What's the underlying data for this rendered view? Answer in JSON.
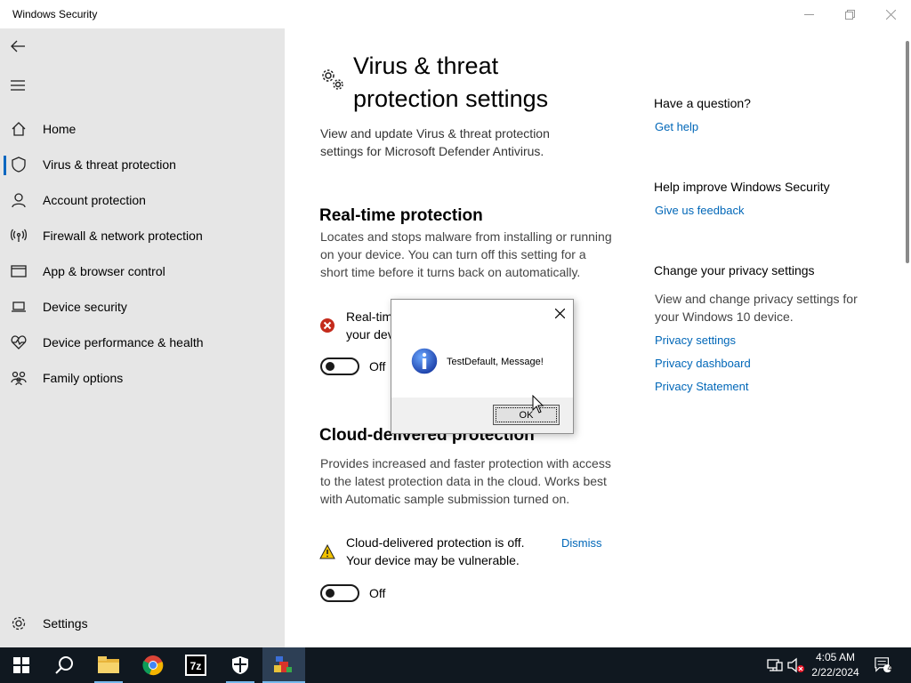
{
  "window": {
    "title": "Windows Security"
  },
  "sidebar": {
    "items": [
      {
        "label": "Home",
        "icon": "home-icon"
      },
      {
        "label": "Virus & threat protection",
        "icon": "shield-icon",
        "active": true
      },
      {
        "label": "Account protection",
        "icon": "person-icon"
      },
      {
        "label": "Firewall & network protection",
        "icon": "wifi-antenna-icon"
      },
      {
        "label": "App & browser control",
        "icon": "browser-window-icon"
      },
      {
        "label": "Device security",
        "icon": "laptop-icon"
      },
      {
        "label": "Device performance & health",
        "icon": "heart-icon"
      },
      {
        "label": "Family options",
        "icon": "family-icon"
      }
    ],
    "settings_label": "Settings",
    "accent": "#0067c0"
  },
  "main": {
    "title": "Virus & threat protection settings",
    "description": "View and update Virus & threat protection settings for Microsoft Defender Antivirus.",
    "realtime": {
      "title": "Real-time protection",
      "description": "Locates and stops malware from installing or running on your device. You can turn off this setting for a short time before it turns back on automatically.",
      "warning": "Real-time protection is off, leaving your device vulnerable.",
      "toggle_label": "Off"
    },
    "cloud": {
      "title": "Cloud-delivered protection",
      "description": "Provides increased and faster protection with access to the latest protection data in the cloud. Works best with Automatic sample submission turned on.",
      "warning": "Cloud-delivered protection is off. Your device may be vulnerable.",
      "dismiss_label": "Dismiss",
      "toggle_label": "Off"
    }
  },
  "aside": {
    "question": {
      "heading": "Have a question?",
      "link": "Get help"
    },
    "improve": {
      "heading": "Help improve Windows Security",
      "link": "Give us feedback"
    },
    "privacy": {
      "heading": "Change your privacy settings",
      "text": "View and change privacy settings for your Windows 10 device.",
      "links": [
        "Privacy settings",
        "Privacy dashboard",
        "Privacy Statement"
      ]
    },
    "link_color": "#0067b8"
  },
  "dialog": {
    "message": "TestDefault, Message!",
    "ok_label": "OK"
  },
  "taskbar": {
    "apps": [
      "windows-start-icon",
      "search-icon",
      "file-explorer-icon",
      "chrome-icon",
      "7zip-icon",
      "windows-security-icon",
      "test-app-icon"
    ],
    "time": "4:05 AM",
    "date": "2/22/2024",
    "notification_count": "4"
  }
}
